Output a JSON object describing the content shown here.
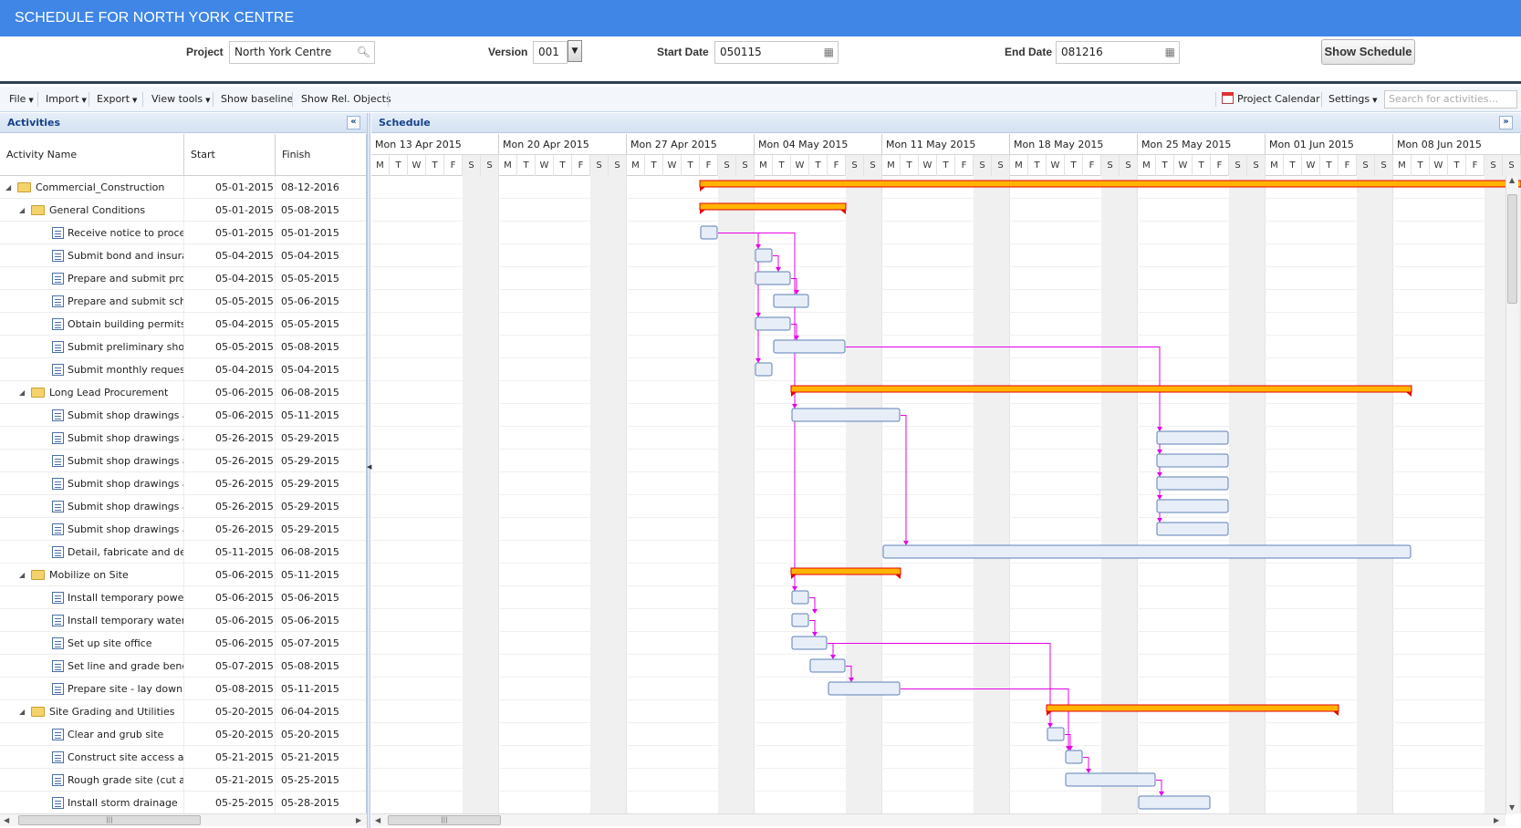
{
  "window": {
    "title": "SCHEDULE FOR NORTH YORK CENTRE"
  },
  "filters": {
    "project_label": "Project",
    "project_value": "North York Centre",
    "version_label": "Version",
    "version_value": "001",
    "start_label": "Start Date",
    "start_value": "050115",
    "end_label": "End Date",
    "end_value": "081216",
    "show_button": "Show Schedule"
  },
  "toolbar": {
    "file": "File",
    "import": "Import",
    "export": "Export",
    "view_tools": "View tools",
    "show_baseline": "Show baseline",
    "show_rel": "Show Rel. Objects",
    "project_calendar": "Project Calendar",
    "settings": "Settings",
    "search_placeholder": "Search for activities..."
  },
  "activities_panel": {
    "title": "Activities",
    "columns": {
      "name": "Activity Name",
      "start": "Start",
      "finish": "Finish"
    },
    "rows": [
      {
        "name": "Commercial_Construction",
        "start": "05-01-2015",
        "finish": "08-12-2016",
        "level": 0,
        "type": "folder"
      },
      {
        "name": "General Conditions",
        "start": "05-01-2015",
        "finish": "05-08-2015",
        "level": 1,
        "type": "folder"
      },
      {
        "name": "Receive notice to proceed",
        "start": "05-01-2015",
        "finish": "05-01-2015",
        "level": 2,
        "type": "task"
      },
      {
        "name": "Submit bond and insuranc",
        "start": "05-04-2015",
        "finish": "05-04-2015",
        "level": 2,
        "type": "task"
      },
      {
        "name": "Prepare and submit proje",
        "start": "05-04-2015",
        "finish": "05-05-2015",
        "level": 2,
        "type": "task"
      },
      {
        "name": "Prepare and submit sched",
        "start": "05-05-2015",
        "finish": "05-06-2015",
        "level": 2,
        "type": "task"
      },
      {
        "name": "Obtain building permits",
        "start": "05-04-2015",
        "finish": "05-05-2015",
        "level": 2,
        "type": "task"
      },
      {
        "name": "Submit preliminary shop d",
        "start": "05-05-2015",
        "finish": "05-08-2015",
        "level": 2,
        "type": "task"
      },
      {
        "name": "Submit monthly requests f",
        "start": "05-04-2015",
        "finish": "05-04-2015",
        "level": 2,
        "type": "task"
      },
      {
        "name": "Long Lead Procurement",
        "start": "05-06-2015",
        "finish": "06-08-2015",
        "level": 1,
        "type": "folder"
      },
      {
        "name": "Submit shop drawings and",
        "start": "05-06-2015",
        "finish": "05-11-2015",
        "level": 2,
        "type": "task"
      },
      {
        "name": "Submit shop drawings and",
        "start": "05-26-2015",
        "finish": "05-29-2015",
        "level": 2,
        "type": "task"
      },
      {
        "name": "Submit shop drawings and",
        "start": "05-26-2015",
        "finish": "05-29-2015",
        "level": 2,
        "type": "task"
      },
      {
        "name": "Submit shop drawings and",
        "start": "05-26-2015",
        "finish": "05-29-2015",
        "level": 2,
        "type": "task"
      },
      {
        "name": "Submit shop drawings and",
        "start": "05-26-2015",
        "finish": "05-29-2015",
        "level": 2,
        "type": "task"
      },
      {
        "name": "Submit shop drawings and",
        "start": "05-26-2015",
        "finish": "05-29-2015",
        "level": 2,
        "type": "task"
      },
      {
        "name": "Detail, fabricate and deliv",
        "start": "05-11-2015",
        "finish": "06-08-2015",
        "level": 2,
        "type": "task"
      },
      {
        "name": "Mobilize on Site",
        "start": "05-06-2015",
        "finish": "05-11-2015",
        "level": 1,
        "type": "folder"
      },
      {
        "name": "Install temporary power",
        "start": "05-06-2015",
        "finish": "05-06-2015",
        "level": 2,
        "type": "task"
      },
      {
        "name": "Install temporary water s",
        "start": "05-06-2015",
        "finish": "05-06-2015",
        "level": 2,
        "type": "task"
      },
      {
        "name": "Set up site office",
        "start": "05-06-2015",
        "finish": "05-07-2015",
        "level": 2,
        "type": "task"
      },
      {
        "name": "Set line and grade bench",
        "start": "05-07-2015",
        "finish": "05-08-2015",
        "level": 2,
        "type": "task"
      },
      {
        "name": "Prepare site - lay down y",
        "start": "05-08-2015",
        "finish": "05-11-2015",
        "level": 2,
        "type": "task"
      },
      {
        "name": "Site Grading and Utilities",
        "start": "05-20-2015",
        "finish": "06-04-2015",
        "level": 1,
        "type": "folder"
      },
      {
        "name": "Clear and grub site",
        "start": "05-20-2015",
        "finish": "05-20-2015",
        "level": 2,
        "type": "task"
      },
      {
        "name": "Construct site access and tem",
        "start": "05-21-2015",
        "finish": "05-21-2015",
        "level": 2,
        "type": "task"
      },
      {
        "name": "Rough grade site (cut and",
        "start": "05-21-2015",
        "finish": "05-25-2015",
        "level": 2,
        "type": "task"
      },
      {
        "name": "Install storm drainage",
        "start": "05-25-2015",
        "finish": "05-28-2015",
        "level": 2,
        "type": "task"
      }
    ]
  },
  "schedule_panel": {
    "title": "Schedule",
    "weeks": [
      "Mon 13 Apr 2015",
      "Mon 20 Apr 2015",
      "Mon 27 Apr 2015",
      "Mon 04 May 2015",
      "Mon 11 May 2015",
      "Mon 18 May 2015",
      "Mon 25 May 2015",
      "Mon 01 Jun 2015",
      "Mon 08 Jun 2015"
    ],
    "day_letters": [
      "M",
      "T",
      "W",
      "T",
      "F",
      "S",
      "S"
    ],
    "timeline_start": "2015-04-13",
    "bars": [
      {
        "row": 0,
        "type": "summary",
        "start": "2015-05-01",
        "end": "2015-08-12"
      },
      {
        "row": 1,
        "type": "summary",
        "start": "2015-05-01",
        "end": "2015-05-08"
      },
      {
        "row": 2,
        "type": "task",
        "start": "2015-05-01",
        "end": "2015-05-01"
      },
      {
        "row": 3,
        "type": "task",
        "start": "2015-05-04",
        "end": "2015-05-04"
      },
      {
        "row": 4,
        "type": "task",
        "start": "2015-05-04",
        "end": "2015-05-05"
      },
      {
        "row": 5,
        "type": "task",
        "start": "2015-05-05",
        "end": "2015-05-06"
      },
      {
        "row": 6,
        "type": "task",
        "start": "2015-05-04",
        "end": "2015-05-05"
      },
      {
        "row": 7,
        "type": "task",
        "start": "2015-05-05",
        "end": "2015-05-08"
      },
      {
        "row": 8,
        "type": "task",
        "start": "2015-05-04",
        "end": "2015-05-04"
      },
      {
        "row": 9,
        "type": "summary",
        "start": "2015-05-06",
        "end": "2015-06-08"
      },
      {
        "row": 10,
        "type": "task",
        "start": "2015-05-06",
        "end": "2015-05-11"
      },
      {
        "row": 11,
        "type": "task",
        "start": "2015-05-26",
        "end": "2015-05-29"
      },
      {
        "row": 12,
        "type": "task",
        "start": "2015-05-26",
        "end": "2015-05-29"
      },
      {
        "row": 13,
        "type": "task",
        "start": "2015-05-26",
        "end": "2015-05-29"
      },
      {
        "row": 14,
        "type": "task",
        "start": "2015-05-26",
        "end": "2015-05-29"
      },
      {
        "row": 15,
        "type": "task",
        "start": "2015-05-26",
        "end": "2015-05-29"
      },
      {
        "row": 16,
        "type": "task",
        "start": "2015-05-11",
        "end": "2015-06-08"
      },
      {
        "row": 17,
        "type": "summary",
        "start": "2015-05-06",
        "end": "2015-05-11"
      },
      {
        "row": 18,
        "type": "task",
        "start": "2015-05-06",
        "end": "2015-05-06"
      },
      {
        "row": 19,
        "type": "task",
        "start": "2015-05-06",
        "end": "2015-05-06"
      },
      {
        "row": 20,
        "type": "task",
        "start": "2015-05-06",
        "end": "2015-05-07"
      },
      {
        "row": 21,
        "type": "task",
        "start": "2015-05-07",
        "end": "2015-05-08"
      },
      {
        "row": 22,
        "type": "task",
        "start": "2015-05-08",
        "end": "2015-05-11"
      },
      {
        "row": 23,
        "type": "summary",
        "start": "2015-05-20",
        "end": "2015-06-04"
      },
      {
        "row": 24,
        "type": "task",
        "start": "2015-05-20",
        "end": "2015-05-20"
      },
      {
        "row": 25,
        "type": "task",
        "start": "2015-05-21",
        "end": "2015-05-21"
      },
      {
        "row": 26,
        "type": "task",
        "start": "2015-05-21",
        "end": "2015-05-25"
      },
      {
        "row": 27,
        "type": "task",
        "start": "2015-05-25",
        "end": "2015-05-28"
      }
    ],
    "links": [
      [
        2,
        3
      ],
      [
        2,
        6
      ],
      [
        2,
        8
      ],
      [
        3,
        4
      ],
      [
        4,
        5
      ],
      [
        6,
        7
      ],
      [
        2,
        10
      ],
      [
        7,
        11
      ],
      [
        7,
        12
      ],
      [
        7,
        13
      ],
      [
        7,
        14
      ],
      [
        7,
        15
      ],
      [
        10,
        16
      ],
      [
        2,
        18
      ],
      [
        18,
        19
      ],
      [
        19,
        20
      ],
      [
        20,
        21
      ],
      [
        21,
        22
      ],
      [
        20,
        24
      ],
      [
        22,
        25
      ],
      [
        24,
        25
      ],
      [
        25,
        26
      ],
      [
        26,
        27
      ]
    ],
    "colors": {
      "summary_fill": "#ffb400",
      "summary_border": "#e60000",
      "task_fill": "#e8eef8",
      "task_border": "#5b7fb6",
      "link": "#e600e6",
      "weekend": "#f0f0f0"
    }
  }
}
